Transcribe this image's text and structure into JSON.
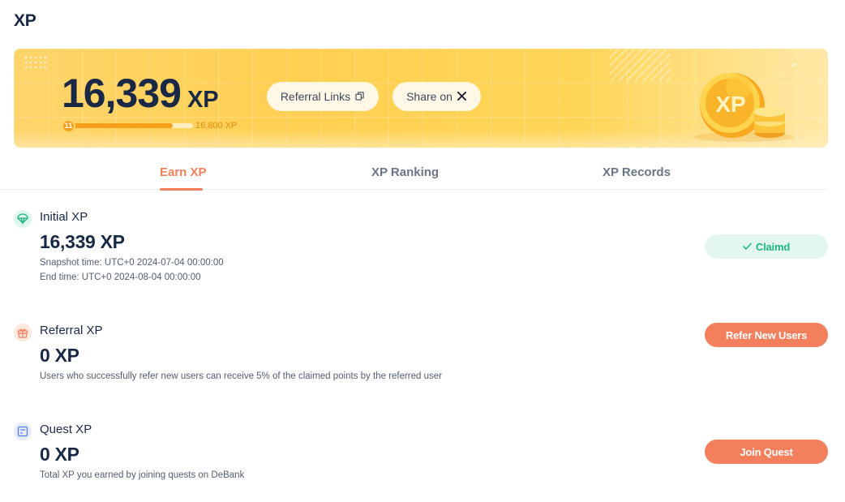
{
  "page": {
    "title": "XP"
  },
  "banner": {
    "xp_value": "16,339",
    "xp_unit": "XP",
    "level": "11",
    "progress_fraction": 0.84,
    "next_level_xp": "16,800 XP",
    "referral_links_label": "Referral Links",
    "share_on_label": "Share on",
    "coin_label": "XP",
    "colors": {
      "banner": "#ffd052",
      "progress": "#f5a01b"
    }
  },
  "tabs": [
    {
      "label": "Earn XP",
      "active": true
    },
    {
      "label": "XP Ranking",
      "active": false
    },
    {
      "label": "XP Records",
      "active": false
    }
  ],
  "sections": {
    "initial": {
      "icon": "parachute-icon",
      "title": "Initial XP",
      "value": "16,339 XP",
      "snapshot_time": "Snapshot time: UTC+0 2024-07-04 00:00:00",
      "end_time": "End time: UTC+0 2024-08-04 00:00:00",
      "button_label": "Claimd"
    },
    "referral": {
      "icon": "gift-icon",
      "title": "Referral XP",
      "value": "0 XP",
      "note": "Users who successfully refer new users can receive 5% of the claimed points by the referred user",
      "button_label": "Refer New Users"
    },
    "quest": {
      "icon": "checklist-icon",
      "title": "Quest XP",
      "value": "0 XP",
      "note": "Total XP you earned by joining quests on DeBank",
      "button_label": "Join Quest"
    }
  },
  "colors": {
    "accent": "#f07f5b",
    "success": "#1fb87c",
    "text": "#192945"
  }
}
